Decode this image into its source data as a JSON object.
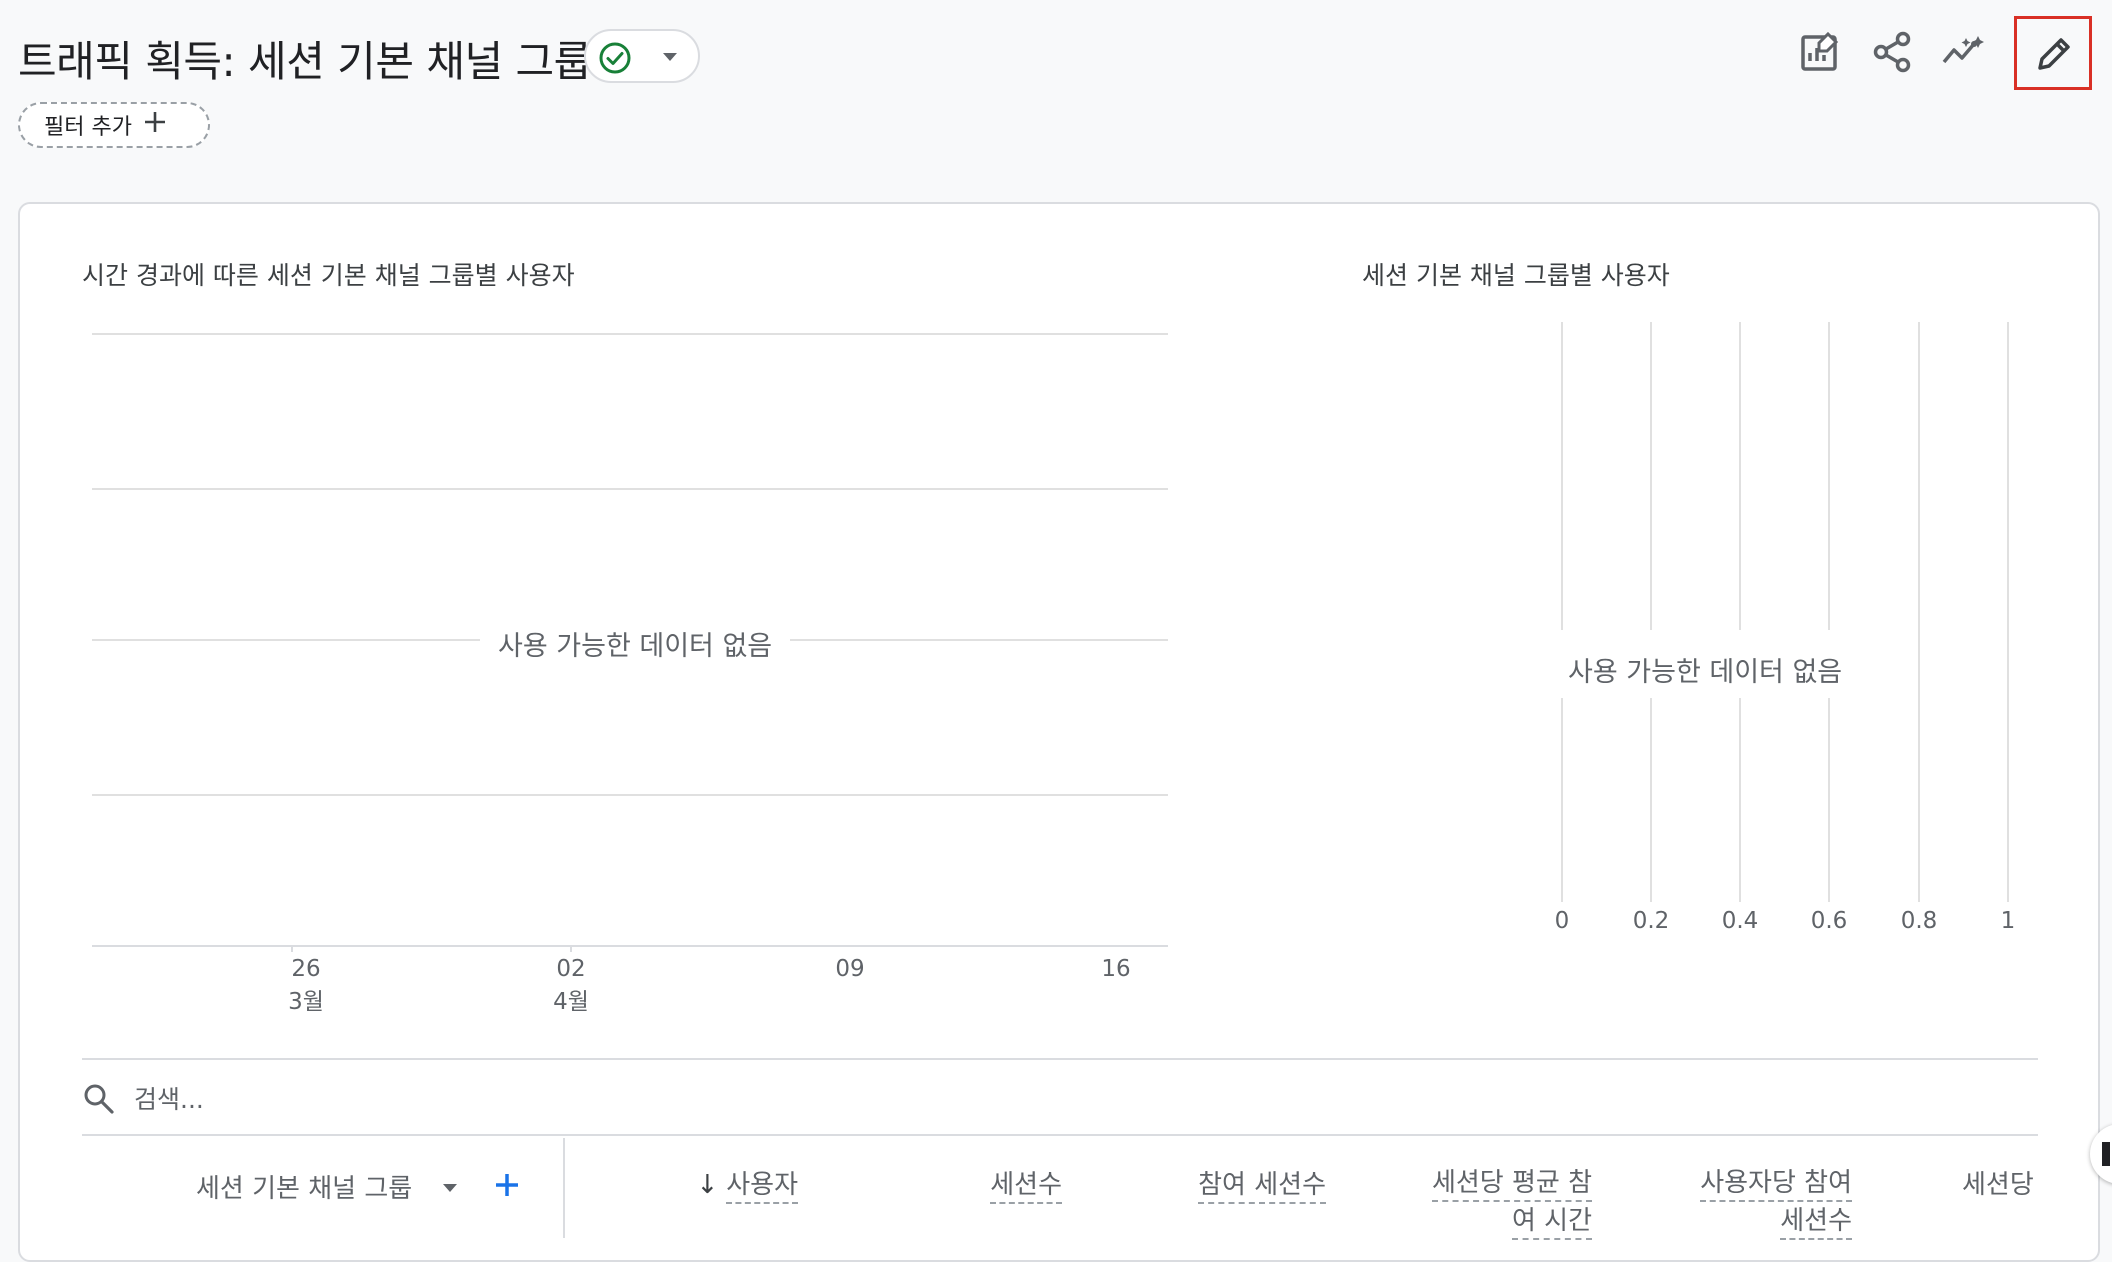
{
  "header": {
    "title": "트래픽 획득: 세션 기본 채널 그룹",
    "filter_chip_label": "필터 추가"
  },
  "toolbar": {
    "icons": [
      "customize-report-icon",
      "share-icon",
      "insights-icon",
      "edit-icon"
    ]
  },
  "timeseries_chart": {
    "title": "시간 경과에 따른 세션 기본 채널 그룹별 사용자",
    "no_data": "사용 가능한 데이터 없음",
    "x_ticks": [
      {
        "day": "26",
        "month": "3월"
      },
      {
        "day": "02",
        "month": "4월"
      },
      {
        "day": "09",
        "month": ""
      },
      {
        "day": "16",
        "month": ""
      }
    ]
  },
  "bar_chart": {
    "title": "세션 기본 채널 그룹별 사용자",
    "no_data": "사용 가능한 데이터 없음",
    "x_ticks": [
      "0",
      "0.2",
      "0.4",
      "0.6",
      "0.8",
      "1"
    ]
  },
  "chart_data": [
    {
      "type": "line",
      "title": "시간 경과에 따른 세션 기본 채널 그룹별 사용자",
      "categories": [
        "26 3월",
        "02 4월",
        "09",
        "16"
      ],
      "series": [],
      "annotations": [
        "사용 가능한 데이터 없음"
      ]
    },
    {
      "type": "bar",
      "title": "세션 기본 채널 그룹별 사용자",
      "categories": [],
      "values": [],
      "xlim": [
        0,
        1
      ],
      "annotations": [
        "사용 가능한 데이터 없음"
      ]
    }
  ],
  "table": {
    "search_placeholder": "검색...",
    "dimension_header": "세션 기본 채널 그룹",
    "sort_arrow": "↓",
    "columns": [
      {
        "line1": "사용자",
        "line2": ""
      },
      {
        "line1": "세션수",
        "line2": ""
      },
      {
        "line1": "참여 세션수",
        "line2": ""
      },
      {
        "line1": "세션당 평균 참",
        "line2": "여 시간"
      },
      {
        "line1": "사용자당 참여",
        "line2": "세션수"
      },
      {
        "line1": "세션당",
        "line2": ""
      }
    ]
  },
  "colors": {
    "status_ok": "#188038",
    "edit_highlight": "#d93025",
    "accent_blue": "#1a73e8"
  }
}
